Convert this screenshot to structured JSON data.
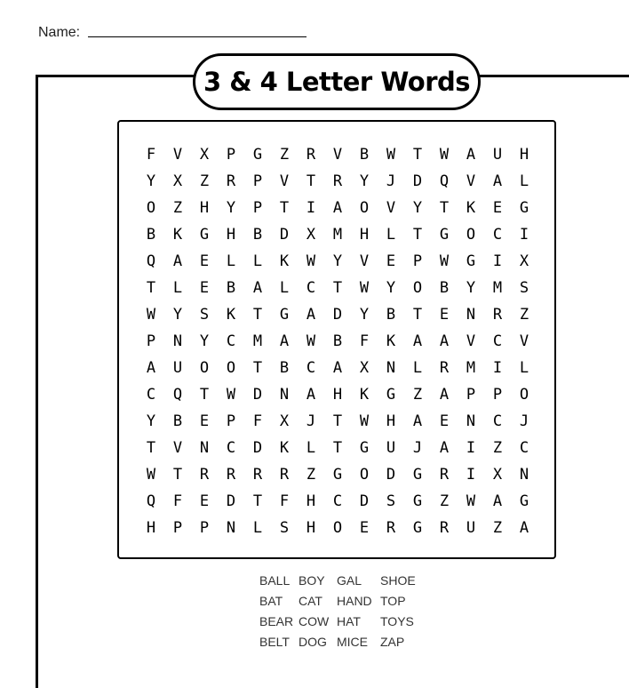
{
  "header": {
    "name_label": "Name:"
  },
  "title": "3 & 4 Letter Words",
  "grid": [
    [
      "F",
      "V",
      "X",
      "P",
      "G",
      "Z",
      "R",
      "V",
      "B",
      "W",
      "T",
      "W",
      "A",
      "U",
      "H"
    ],
    [
      "Y",
      "X",
      "Z",
      "R",
      "P",
      "V",
      "T",
      "R",
      "Y",
      "J",
      "D",
      "Q",
      "V",
      "A",
      "L"
    ],
    [
      "O",
      "Z",
      "H",
      "Y",
      "P",
      "T",
      "I",
      "A",
      "O",
      "V",
      "Y",
      "T",
      "K",
      "E",
      "G"
    ],
    [
      "B",
      "K",
      "G",
      "H",
      "B",
      "D",
      "X",
      "M",
      "H",
      "L",
      "T",
      "G",
      "O",
      "C",
      "I"
    ],
    [
      "Q",
      "A",
      "E",
      "L",
      "L",
      "K",
      "W",
      "Y",
      "V",
      "E",
      "P",
      "W",
      "G",
      "I",
      "X"
    ],
    [
      "T",
      "L",
      "E",
      "B",
      "A",
      "L",
      "C",
      "T",
      "W",
      "Y",
      "O",
      "B",
      "Y",
      "M",
      "S"
    ],
    [
      "W",
      "Y",
      "S",
      "K",
      "T",
      "G",
      "A",
      "D",
      "Y",
      "B",
      "T",
      "E",
      "N",
      "R",
      "Z"
    ],
    [
      "P",
      "N",
      "Y",
      "C",
      "M",
      "A",
      "W",
      "B",
      "F",
      "K",
      "A",
      "A",
      "V",
      "C",
      "V"
    ],
    [
      "A",
      "U",
      "O",
      "O",
      "T",
      "B",
      "C",
      "A",
      "X",
      "N",
      "L",
      "R",
      "M",
      "I",
      "L"
    ],
    [
      "C",
      "Q",
      "T",
      "W",
      "D",
      "N",
      "A",
      "H",
      "K",
      "G",
      "Z",
      "A",
      "P",
      "P",
      "O"
    ],
    [
      "Y",
      "B",
      "E",
      "P",
      "F",
      "X",
      "J",
      "T",
      "W",
      "H",
      "A",
      "E",
      "N",
      "C",
      "J"
    ],
    [
      "T",
      "V",
      "N",
      "C",
      "D",
      "K",
      "L",
      "T",
      "G",
      "U",
      "J",
      "A",
      "I",
      "Z",
      "C"
    ],
    [
      "W",
      "T",
      "R",
      "R",
      "R",
      "R",
      "Z",
      "G",
      "O",
      "D",
      "G",
      "R",
      "I",
      "X",
      "N"
    ],
    [
      "Q",
      "F",
      "E",
      "D",
      "T",
      "F",
      "H",
      "C",
      "D",
      "S",
      "G",
      "Z",
      "W",
      "A",
      "G"
    ],
    [
      "H",
      "P",
      "P",
      "N",
      "L",
      "S",
      "H",
      "O",
      "E",
      "R",
      "G",
      "R",
      "U",
      "Z",
      "A"
    ]
  ],
  "word_list": {
    "columns": [
      [
        "BALL",
        "BAT",
        "BEAR",
        "BELT"
      ],
      [
        "BOY",
        "CAT",
        "COW",
        "DOG"
      ],
      [
        "GAL",
        "HAND",
        "HAT",
        "MICE"
      ],
      [
        "SHOE",
        "TOP",
        "TOYS",
        "ZAP"
      ]
    ]
  }
}
